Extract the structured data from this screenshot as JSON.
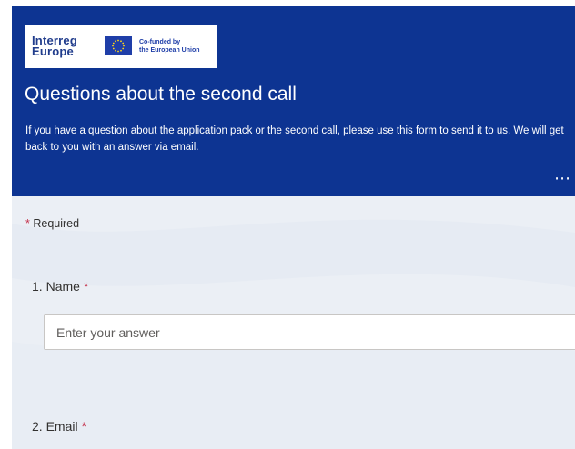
{
  "header": {
    "logo": {
      "line1": "Interreg",
      "line2": "Europe",
      "cofund_line1": "Co-funded by",
      "cofund_line2": "the European Union"
    },
    "title": "Questions about the second call",
    "description": "If you have a question about the application pack or the second call, please use this form to send it to us. We will get back to you with an answer via email.",
    "more_icon": "ellipsis-icon"
  },
  "required_note": {
    "star": "*",
    "text": "Required"
  },
  "questions": [
    {
      "number": "1.",
      "label": "Name",
      "star": "*",
      "placeholder": "Enter your answer"
    },
    {
      "number": "2.",
      "label": "Email",
      "star": "*"
    }
  ],
  "colors": {
    "header_bg": "#0d3492",
    "body_bg": "#ebeff5",
    "required_star": "#c4314b",
    "text": "#323130"
  }
}
